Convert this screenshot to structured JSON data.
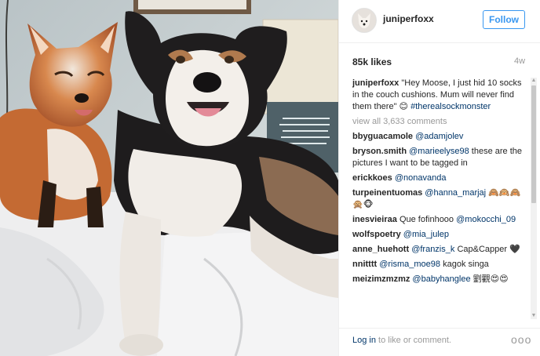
{
  "post": {
    "username": "juniperfoxx",
    "follow_label": "Follow",
    "likes": "85k likes",
    "time_ago": "4w"
  },
  "caption": {
    "username": "juniperfoxx",
    "text": "\"Hey Moose, I just hid 10 socks in the couch cushions. Mum will never find them there\" 😊",
    "hashtag": "#therealsockmonster"
  },
  "view_all": "view all 3,633 comments",
  "comments": [
    {
      "user": "bbyguacamole",
      "mention": "@adamjolev",
      "text": ""
    },
    {
      "user": "bryson.smith",
      "mention": "@marieelyse98",
      "text": "these are the pictures I want to be tagged in"
    },
    {
      "user": "erickkoes",
      "mention": "@nonavanda",
      "text": ""
    },
    {
      "user": "turpeinentuomas",
      "mention": "@hanna_marjaj",
      "text": "🙈🙉🙈🙊🐵"
    },
    {
      "user": "inesvieiraa",
      "mention": "@mokocchi_09",
      "text": "Que fofinhooo",
      "text_before": true
    },
    {
      "user": "wolfspoetry",
      "mention": "@mia_julep",
      "text": ""
    },
    {
      "user": "anne_huehott",
      "mention": "@franzis_k",
      "text": "Cap&Capper 🖤"
    },
    {
      "user": "nnitttt",
      "mention": "@risma_moe98",
      "text": "kagok singa"
    },
    {
      "user": "meizimzmzmz",
      "mention": "@babyhanglee",
      "text": "劉觀😍😍"
    }
  ],
  "footer": {
    "login_link": "Log in",
    "login_rest": " to like or comment.",
    "more": "ooo"
  },
  "colors": {
    "accent": "#3897f0",
    "mention": "#003569",
    "muted": "#999999"
  }
}
